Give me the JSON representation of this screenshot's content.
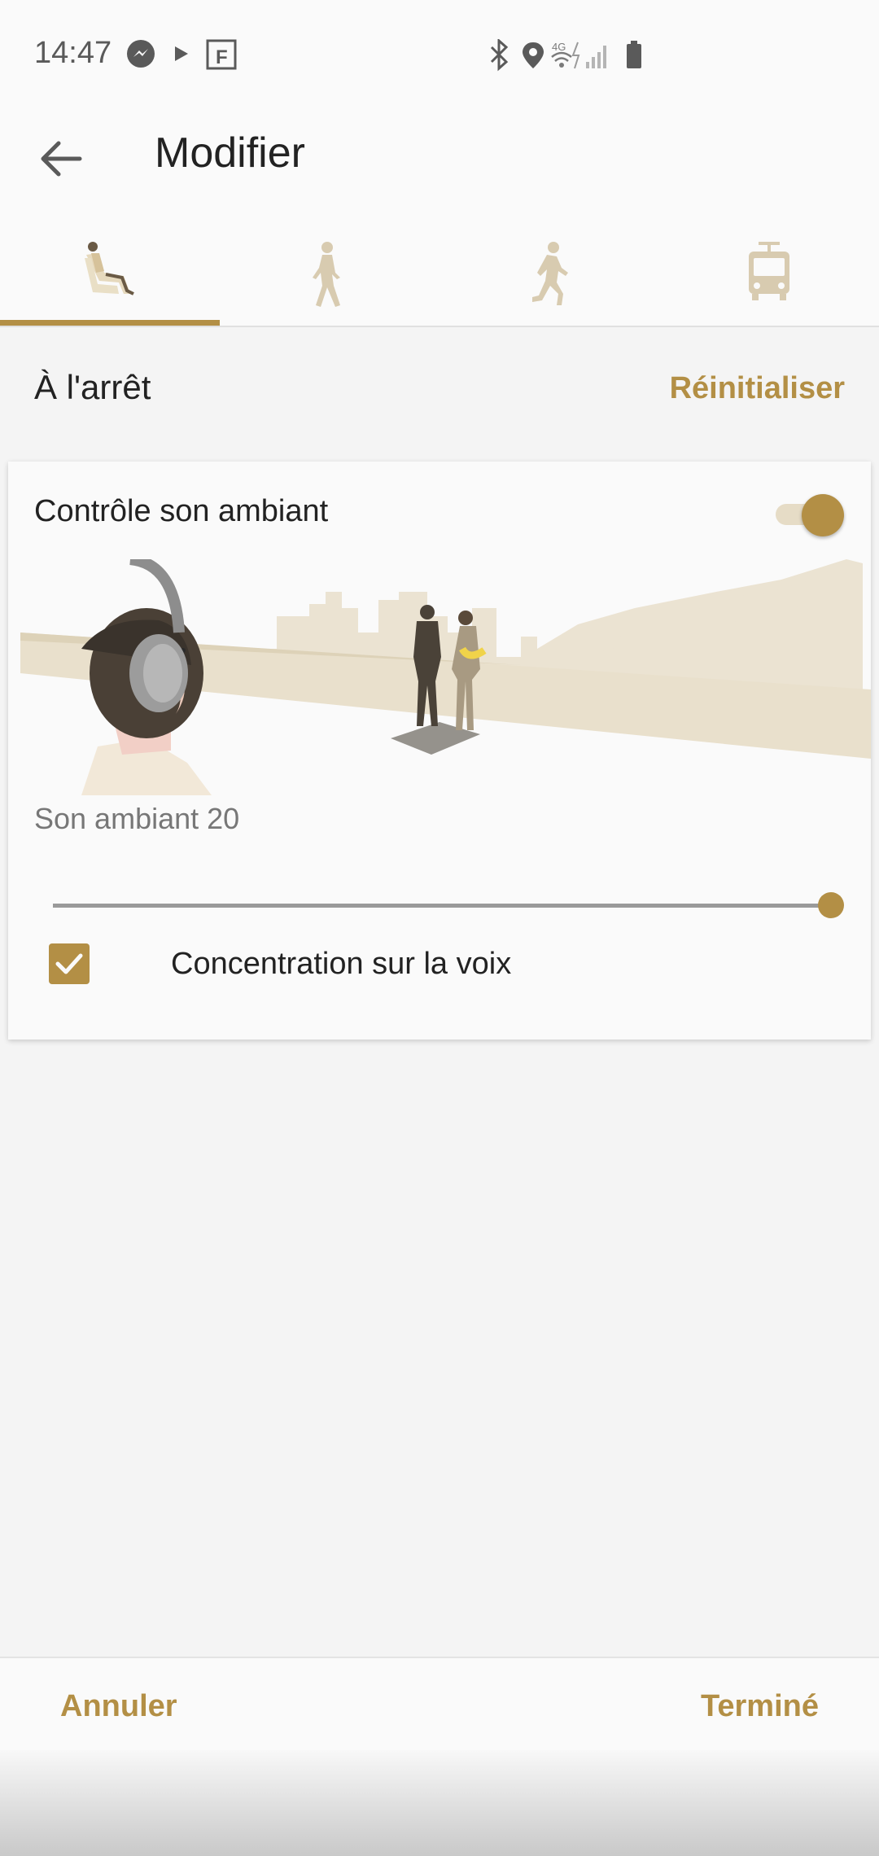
{
  "status_bar": {
    "time": "14:47",
    "left_icons": [
      "messenger-icon",
      "play-icon",
      "flipboard-icon"
    ],
    "right_icons": [
      "bluetooth-icon",
      "location-icon",
      "wifi-4g-icon",
      "signal-icon",
      "battery-icon"
    ]
  },
  "header": {
    "title": "Modifier",
    "back_icon": "arrow-left-icon"
  },
  "tabs": [
    {
      "icon": "sitting-person-icon",
      "selected": true
    },
    {
      "icon": "walking-person-icon",
      "selected": false
    },
    {
      "icon": "running-person-icon",
      "selected": false
    },
    {
      "icon": "tram-icon",
      "selected": false
    }
  ],
  "section": {
    "title": "À l'arrêt",
    "reset_label": "Réinitialiser"
  },
  "card": {
    "title": "Contrôle son ambiant",
    "toggle_on": true,
    "level_label": "Son ambiant 20",
    "slider_value": 20,
    "slider_max": 20,
    "checkbox_label": "Concentration sur la voix",
    "checkbox_checked": true
  },
  "footer": {
    "cancel_label": "Annuler",
    "done_label": "Terminé"
  },
  "colors": {
    "accent": "#b38f45",
    "background": "#f4f4f4",
    "surface": "#fafafa"
  }
}
